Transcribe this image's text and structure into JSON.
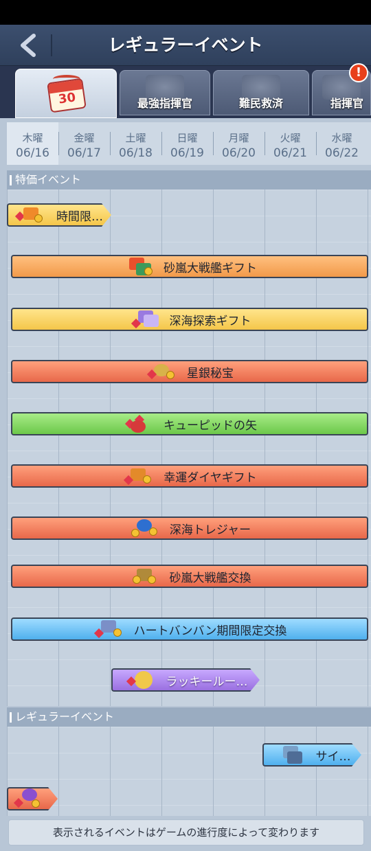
{
  "header": {
    "title": "レギュラーイベント"
  },
  "tabs": [
    {
      "label": "",
      "icon": "calendar-30-icon",
      "calendar_number": "30"
    },
    {
      "label": "最強指揮官",
      "icon": "commander-icon"
    },
    {
      "label": "難民救済",
      "icon": "sos-icon"
    },
    {
      "label": "指揮官",
      "icon": "commander2-icon"
    }
  ],
  "alert_badge": "!",
  "days": [
    {
      "weekday": "木曜",
      "date": "06/16"
    },
    {
      "weekday": "金曜",
      "date": "06/17"
    },
    {
      "weekday": "土曜",
      "date": "06/18"
    },
    {
      "weekday": "日曜",
      "date": "06/19"
    },
    {
      "weekday": "月曜",
      "date": "06/20"
    },
    {
      "weekday": "火曜",
      "date": "06/21"
    },
    {
      "weekday": "水曜",
      "date": "06/22"
    }
  ],
  "sections": {
    "special": "特価イベント",
    "regular": "レギュラーイベント"
  },
  "special_events": [
    {
      "label": "時間限…",
      "color": "yellow"
    },
    {
      "label": "砂嵐大戦艦ギフト",
      "color": "orange"
    },
    {
      "label": "深海探索ギフト",
      "color": "yellow"
    },
    {
      "label": "星銀秘宝",
      "color": "red"
    },
    {
      "label": "キューピッドの矢",
      "color": "green"
    },
    {
      "label": "幸運ダイヤギフト",
      "color": "red"
    },
    {
      "label": "深海トレジャー",
      "color": "red"
    },
    {
      "label": "砂嵐大戦艦交換",
      "color": "red"
    },
    {
      "label": "ハートバンバン期間限定交換",
      "color": "blue"
    },
    {
      "label": "ラッキールー…",
      "color": "purple"
    }
  ],
  "regular_events": [
    {
      "label": "サイ…",
      "color": "blue"
    },
    {
      "label": "",
      "color": "red"
    }
  ],
  "footer": "表示されるイベントはゲームの進行度によって変わります"
}
